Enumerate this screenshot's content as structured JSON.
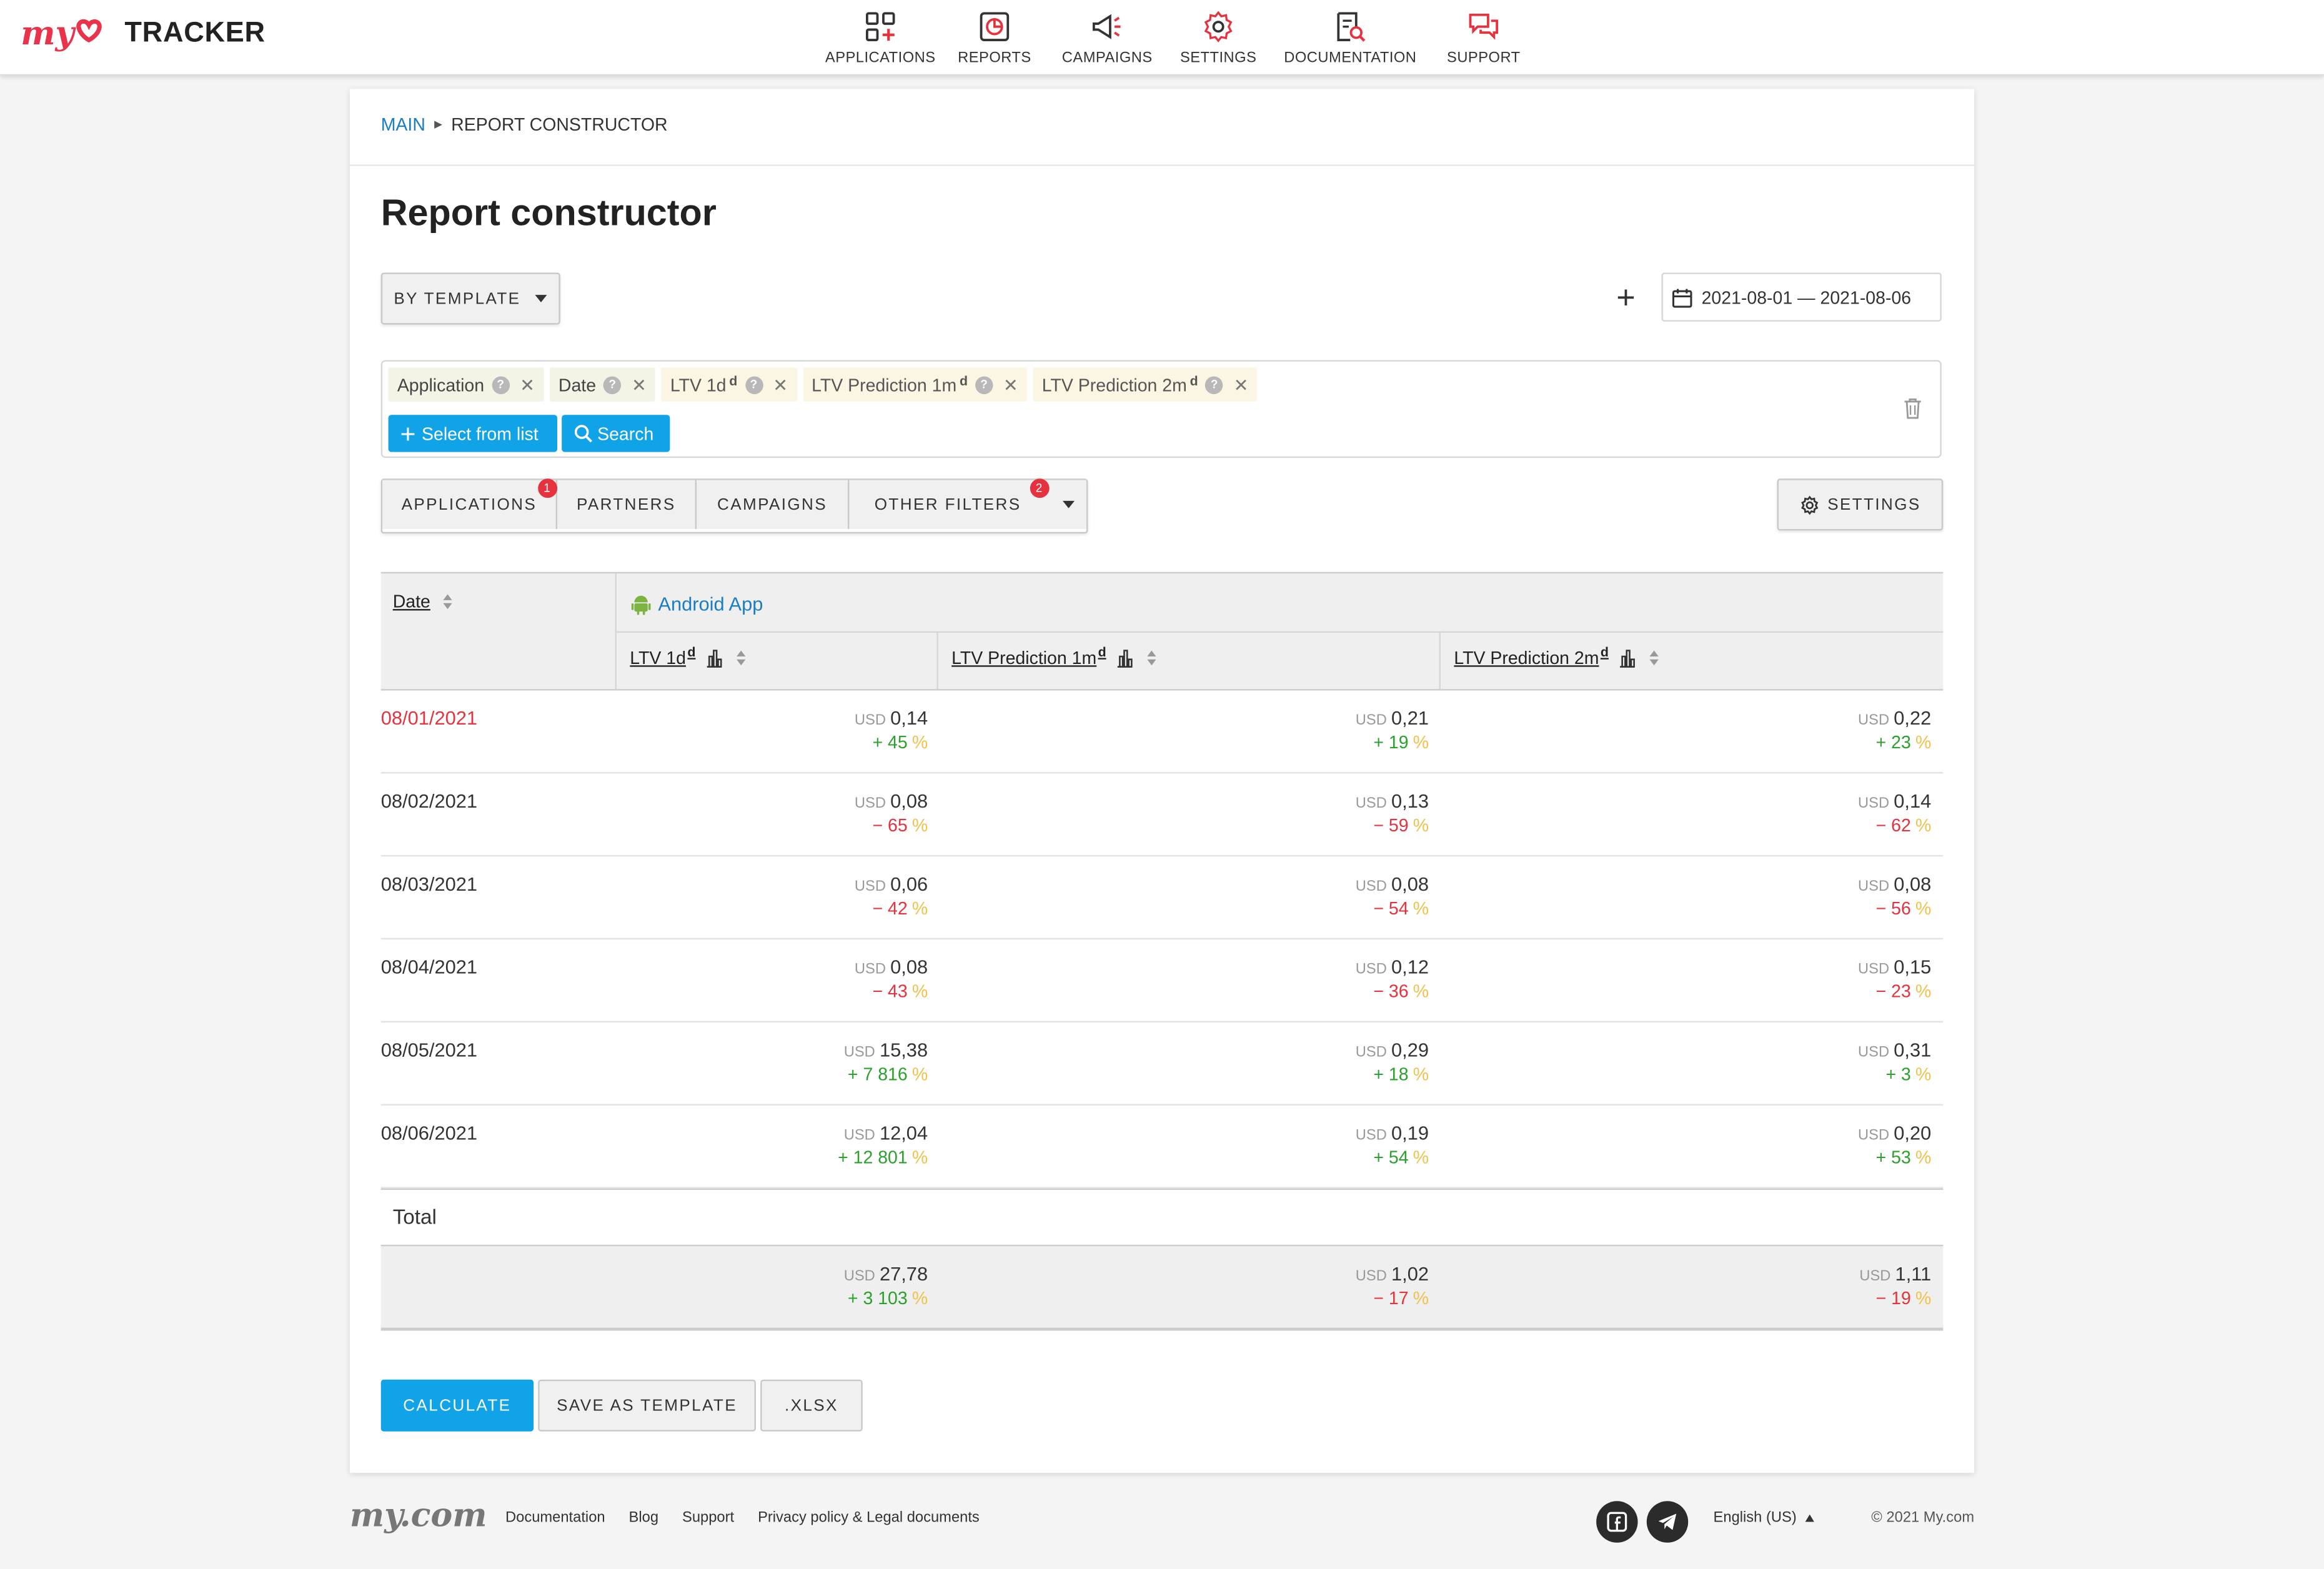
{
  "brand": {
    "logo_prefix": "my",
    "logo_name": "TRACKER",
    "accent": "#e8334a"
  },
  "nav": [
    {
      "label": "APPLICATIONS",
      "icon": "applications-icon"
    },
    {
      "label": "REPORTS",
      "icon": "reports-icon"
    },
    {
      "label": "CAMPAIGNS",
      "icon": "campaigns-icon"
    },
    {
      "label": "SETTINGS",
      "icon": "gear-icon"
    },
    {
      "label": "DOCUMENTATION",
      "icon": "documentation-icon"
    },
    {
      "label": "SUPPORT",
      "icon": "support-icon"
    }
  ],
  "breadcrumb": {
    "main": "MAIN",
    "current": "REPORT CONSTRUCTOR"
  },
  "page": {
    "title": "Report constructor"
  },
  "toolbar": {
    "by_template": "BY TEMPLATE",
    "plus": "+",
    "date_range": "2021-08-01 — 2021-08-06"
  },
  "chips": [
    {
      "label": "Application",
      "sup": "",
      "kind": "dim"
    },
    {
      "label": "Date",
      "sup": "",
      "kind": "dim"
    },
    {
      "label": "LTV 1d",
      "sup": "d",
      "kind": "met"
    },
    {
      "label": "LTV Prediction 1m",
      "sup": "d",
      "kind": "met"
    },
    {
      "label": "LTV Prediction 2m",
      "sup": "d",
      "kind": "met"
    }
  ],
  "chip_actions": {
    "select_from_list": "Select from list",
    "search": "Search"
  },
  "filters": [
    {
      "label": "APPLICATIONS",
      "badge": "1"
    },
    {
      "label": "PARTNERS",
      "badge": ""
    },
    {
      "label": "CAMPAIGNS",
      "badge": ""
    },
    {
      "label": "OTHER FILTERS",
      "badge": "2"
    }
  ],
  "settings_label": "SETTINGS",
  "table": {
    "date_header": "Date",
    "app_name": "Android App",
    "columns": [
      {
        "label": "LTV 1d",
        "sup": "d"
      },
      {
        "label": "LTV Prediction 1m",
        "sup": "d"
      },
      {
        "label": "LTV Prediction 2m",
        "sup": "d"
      }
    ],
    "currency": "USD",
    "pct_symbol": "%",
    "rows": [
      {
        "date": "08/01/2021",
        "highlight": true,
        "cells": [
          {
            "value": "0,14",
            "delta": "+ 45",
            "dir": "pos"
          },
          {
            "value": "0,21",
            "delta": "+ 19",
            "dir": "pos"
          },
          {
            "value": "0,22",
            "delta": "+ 23",
            "dir": "pos"
          }
        ]
      },
      {
        "date": "08/02/2021",
        "highlight": false,
        "cells": [
          {
            "value": "0,08",
            "delta": "− 65",
            "dir": "neg"
          },
          {
            "value": "0,13",
            "delta": "− 59",
            "dir": "neg"
          },
          {
            "value": "0,14",
            "delta": "− 62",
            "dir": "neg"
          }
        ]
      },
      {
        "date": "08/03/2021",
        "highlight": false,
        "cells": [
          {
            "value": "0,06",
            "delta": "− 42",
            "dir": "neg"
          },
          {
            "value": "0,08",
            "delta": "− 54",
            "dir": "neg"
          },
          {
            "value": "0,08",
            "delta": "− 56",
            "dir": "neg"
          }
        ]
      },
      {
        "date": "08/04/2021",
        "highlight": false,
        "cells": [
          {
            "value": "0,08",
            "delta": "− 43",
            "dir": "neg"
          },
          {
            "value": "0,12",
            "delta": "− 36",
            "dir": "neg"
          },
          {
            "value": "0,15",
            "delta": "− 23",
            "dir": "neg"
          }
        ]
      },
      {
        "date": "08/05/2021",
        "highlight": false,
        "cells": [
          {
            "value": "15,38",
            "delta": "+ 7 816",
            "dir": "pos"
          },
          {
            "value": "0,29",
            "delta": "+ 18",
            "dir": "pos"
          },
          {
            "value": "0,31",
            "delta": "+ 3",
            "dir": "pos"
          }
        ]
      },
      {
        "date": "08/06/2021",
        "highlight": false,
        "cells": [
          {
            "value": "12,04",
            "delta": "+ 12 801",
            "dir": "pos"
          },
          {
            "value": "0,19",
            "delta": "+ 54",
            "dir": "pos"
          },
          {
            "value": "0,20",
            "delta": "+ 53",
            "dir": "pos"
          }
        ]
      }
    ],
    "total_label": "Total",
    "totals": [
      {
        "value": "27,78",
        "delta": "+ 3 103",
        "dir": "pos"
      },
      {
        "value": "1,02",
        "delta": "− 17",
        "dir": "neg"
      },
      {
        "value": "1,11",
        "delta": "− 19",
        "dir": "neg"
      }
    ]
  },
  "actions": {
    "calculate": "CALCULATE",
    "save_template": "SAVE AS TEMPLATE",
    "xlsx": ".XLSX"
  },
  "footer": {
    "logo": "my.com",
    "links": [
      "Documentation",
      "Blog",
      "Support",
      "Privacy policy & Legal documents"
    ],
    "language": "English (US)",
    "copyright": "© 2021 My.com"
  },
  "colors": {
    "primary": "#10a3e8",
    "link": "#1b7ec2",
    "positive": "#2ca02c",
    "negative": "#e6323e",
    "badge": "#e6323e"
  }
}
